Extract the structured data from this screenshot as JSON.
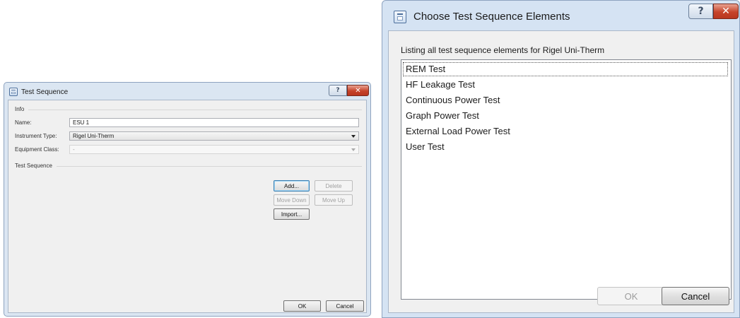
{
  "test_sequence_dialog": {
    "title": "Test Sequence",
    "info_group": {
      "label": "Info",
      "name_label": "Name:",
      "name_value": "ESU 1",
      "instrument_type_label": "Instrument Type:",
      "instrument_type_value": "Rigel Uni-Therm",
      "equipment_class_label": "Equipment Class:",
      "equipment_class_value": "-"
    },
    "test_sequence_group": {
      "label": "Test Sequence",
      "buttons": {
        "add": "Add...",
        "delete": "Delete",
        "move_down": "Move Down",
        "move_up": "Move Up",
        "import": "Import..."
      }
    },
    "footer": {
      "ok": "OK",
      "cancel": "Cancel"
    }
  },
  "choose_elements_dialog": {
    "title": "Choose Test Sequence Elements",
    "caption": "Listing all test sequence elements for Rigel Uni-Therm",
    "items": [
      "REM Test",
      "HF Leakage Test",
      "Continuous Power Test",
      "Graph Power Test",
      "External Load Power Test",
      "User Test"
    ],
    "footer": {
      "ok": "OK",
      "cancel": "Cancel"
    }
  },
  "titlebar_glyphs": {
    "help": "?",
    "close": "✕"
  },
  "colors": {
    "close_button": "#c6432a",
    "default_button_border": "#3c7fb1",
    "window_frame": "#d5e3f3"
  }
}
